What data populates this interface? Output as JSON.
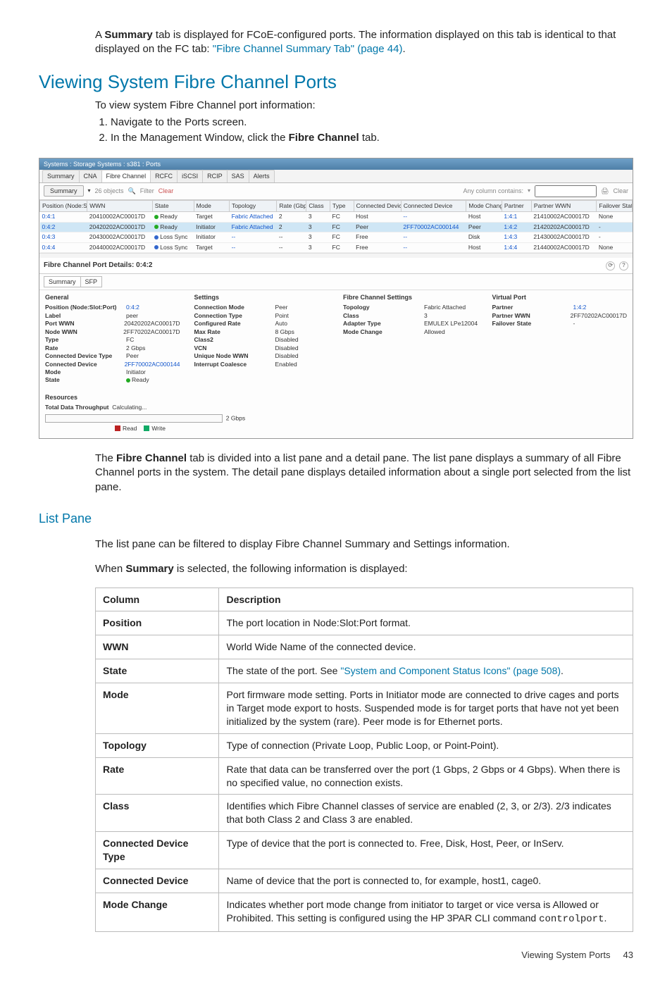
{
  "intro": {
    "p1_a": "A ",
    "p1_b": "Summary",
    "p1_c": " tab is displayed for FCoE-configured ports. The information displayed on this tab is identical to that displayed on the FC tab: ",
    "p1_link": "\"Fibre Channel Summary Tab\" (page 44)",
    "p1_d": "."
  },
  "heading1": "Viewing System Fibre Channel Ports",
  "lead": "To view system Fibre Channel port information:",
  "steps": {
    "s1": "Navigate to the Ports screen.",
    "s2_a": "In the Management Window, click the ",
    "s2_b": "Fibre Channel",
    "s2_c": " tab."
  },
  "screenshot": {
    "breadcrumb": "Systems : Storage Systems : s381 : Ports",
    "tabs": [
      "Summary",
      "CNA",
      "Fibre Channel",
      "RCFC",
      "iSCSI",
      "RCIP",
      "SAS",
      "Alerts"
    ],
    "activeTab": 2,
    "toolbar": {
      "summary_btn": "Summary",
      "objects": "26 objects",
      "filter": "Filter",
      "clear": "Clear",
      "anycol": "Any column contains:",
      "clear2": "Clear"
    },
    "grid": {
      "headers": [
        "Position (Node:Slot:Port)",
        "WWN",
        "State",
        "Mode",
        "Topology",
        "Rate (Gbps)",
        "Class",
        "Type",
        "Connected Device Type",
        "Connected Device",
        "Mode Change",
        "Partner",
        "Partner WWN",
        "Failover State"
      ],
      "rows": [
        {
          "pos": "0:4:1",
          "wwn": "20410002AC00017D",
          "stateDot": "green",
          "state": "Ready",
          "mode": "Target",
          "topo": "Fabric Attached",
          "rate": "2",
          "class": "3",
          "type": "FC",
          "cdt": "Host",
          "cd": "--",
          "mc": "Host",
          "partner": "1:4:1",
          "pwwn": "21410002AC00017D",
          "fail": "None"
        },
        {
          "pos": "0:4:2",
          "wwn": "20420202AC00017D",
          "stateDot": "green",
          "state": "Ready",
          "mode": "Initiator",
          "topo": "Fabric Attached",
          "rate": "2",
          "class": "3",
          "type": "FC",
          "cdt": "Peer",
          "cd": "2FF70002AC000144",
          "mc": "Peer",
          "partner": "1:4:2",
          "pwwn": "21420202AC00017D",
          "fail": "-",
          "sel": true
        },
        {
          "pos": "0:4:3",
          "wwn": "20430002AC00017D",
          "stateDot": "blue",
          "state": "Loss Sync",
          "mode": "Initiator",
          "topo": "--",
          "rate": "--",
          "class": "3",
          "type": "FC",
          "cdt": "Free",
          "cd": "--",
          "mc": "Disk",
          "partner": "1:4:3",
          "pwwn": "21430002AC00017D",
          "fail": "-"
        },
        {
          "pos": "0:4:4",
          "wwn": "20440002AC00017D",
          "stateDot": "blue",
          "state": "Loss Sync",
          "mode": "Target",
          "topo": "--",
          "rate": "--",
          "class": "3",
          "type": "FC",
          "cdt": "Free",
          "cd": "--",
          "mc": "Host",
          "partner": "1:4:4",
          "pwwn": "21440002AC00017D",
          "fail": "None"
        }
      ]
    },
    "detail": {
      "title": "Fibre Channel Port Details: 0:4:2",
      "tabs": [
        "Summary",
        "SFP"
      ],
      "general": {
        "title": "General",
        "rows": [
          [
            "Position (Node:Slot:Port)",
            "0:4:2"
          ],
          [
            "Label",
            "peer"
          ],
          [
            "Port WWN",
            "20420202AC00017D"
          ],
          [
            "Node WWN",
            "2FF70202AC00017D"
          ],
          [
            "Type",
            "FC"
          ],
          [
            "Rate",
            "2 Gbps"
          ],
          [
            "Connected Device Type",
            "Peer"
          ],
          [
            "Connected Device",
            "2FF70002AC000144"
          ],
          [
            "Mode",
            "Initiator"
          ],
          [
            "State",
            "Ready"
          ]
        ],
        "stateDot": "green"
      },
      "settings": {
        "title": "Settings",
        "rows": [
          [
            "Connection Mode",
            "Peer"
          ],
          [
            "Connection Type",
            "Point"
          ],
          [
            "Configured Rate",
            "Auto"
          ],
          [
            "Max Rate",
            "8 Gbps"
          ],
          [
            "Class2",
            "Disabled"
          ],
          [
            "VCN",
            "Disabled"
          ],
          [
            "Unique Node WWN",
            "Disabled"
          ],
          [
            "Interrupt Coalesce",
            "Enabled"
          ]
        ]
      },
      "fcsettings": {
        "title": "Fibre Channel Settings",
        "rows": [
          [
            "Topology",
            "Fabric Attached"
          ],
          [
            "Class",
            "3"
          ],
          [
            "Adapter Type",
            "EMULEX LPe12004"
          ],
          [
            "Mode Change",
            "Allowed"
          ]
        ]
      },
      "vport": {
        "title": "Virtual Port",
        "rows": [
          [
            "Partner",
            "1:4:2"
          ],
          [
            "Partner WWN",
            "2FF70202AC00017D"
          ],
          [
            "Failover State",
            "-"
          ]
        ]
      },
      "resources": {
        "title": "Resources",
        "tdt_label": "Total Data Throughput",
        "tdt_value": "Calculating...",
        "rate": "2 Gbps",
        "legend_read": "Read",
        "legend_write": "Write"
      }
    }
  },
  "post": {
    "p1_a": "The ",
    "p1_b": "Fibre Channel",
    "p1_c": " tab is divided into a list pane and a detail pane. The list pane displays a summary of all Fibre Channel ports in the system. The detail pane displays detailed information about a single port selected from the list pane."
  },
  "listPane": {
    "heading": "List Pane",
    "p1": "The list pane can be filtered to display Fibre Channel Summary and Settings information.",
    "p2_a": "When ",
    "p2_b": "Summary",
    "p2_c": " is selected, the following information is displayed:"
  },
  "infotable": {
    "head": [
      "Column",
      "Description"
    ],
    "rows": [
      {
        "col": "Position",
        "desc": "The port location in Node:Slot:Port format."
      },
      {
        "col": "WWN",
        "desc": "World Wide Name of the connected device."
      },
      {
        "col": "State",
        "desc_pre": "The state of the port. See ",
        "link": "\"System and Component Status Icons\" (page 508)",
        "desc_post": "."
      },
      {
        "col": "Mode",
        "desc": "Port firmware mode setting. Ports in Initiator mode are connected to drive cages and ports in Target mode export to hosts. Suspended mode is for target ports that have not yet been initialized by the system (rare). Peer mode is for Ethernet ports."
      },
      {
        "col": "Topology",
        "desc": "Type of connection (Private Loop, Public Loop, or Point-Point)."
      },
      {
        "col": "Rate",
        "desc": "Rate that data can be transferred over the port (1 Gbps, 2 Gbps or 4 Gbps). When there is no specified value, no connection exists."
      },
      {
        "col": "Class",
        "desc": "Identifies which Fibre Channel classes of service are enabled (2, 3, or 2/3). 2/3 indicates that both Class 2 and Class 3 are enabled."
      },
      {
        "col": "Connected Device Type",
        "desc": "Type of device that the port is connected to. Free, Disk, Host, Peer, or InServ."
      },
      {
        "col": "Connected Device",
        "desc": "Name of device that the port is connected to, for example, host1, cage0."
      },
      {
        "col": "Mode Change",
        "desc_pre": "Indicates whether port mode change from initiator to target or vice versa is Allowed or Prohibited. This setting is configured using the HP 3PAR CLI command ",
        "code": "controlport",
        "desc_post": "."
      }
    ]
  },
  "footer": {
    "label": "Viewing System Ports",
    "page": "43"
  }
}
